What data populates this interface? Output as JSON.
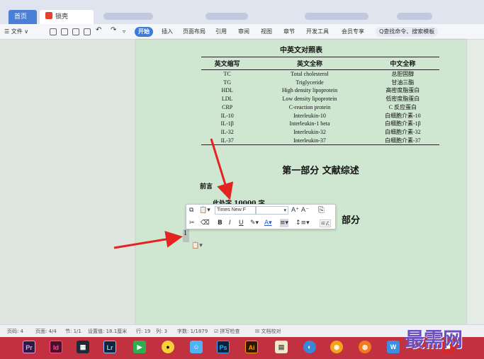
{
  "tabs": {
    "home": "首页",
    "doc": "锁壳"
  },
  "menu": {
    "file": "☰ 文件 ∨",
    "start": "开始",
    "items": [
      "插入",
      "页面布局",
      "引用",
      "审阅",
      "视图",
      "章节",
      "开发工具",
      "会员专享"
    ],
    "search_placeholder": "Q查找命令、搜索模板"
  },
  "doc": {
    "table_title": "中英文对照表",
    "columns": [
      "英文缩写",
      "英文全称",
      "中文全称"
    ],
    "rows": [
      [
        "TC",
        "Total cholesterol",
        "总胆固醇"
      ],
      [
        "TG",
        "Triglyceride",
        "甘油三酯"
      ],
      [
        "HDL",
        "High density lipoprotein",
        "高密度脂蛋白"
      ],
      [
        "LDL",
        "Low density lipoprotein",
        "低密度脂蛋白"
      ],
      [
        "CRP",
        "C-reaction protein",
        "C 反应蛋白"
      ],
      [
        "IL-10",
        "Interleukin-10",
        "白细胞介素-10"
      ],
      [
        "IL-1β",
        "Interleukin-1 beta",
        "白细胞介素-1β"
      ],
      [
        "IL-32",
        "Interleukin-32",
        "白细胞介素-32"
      ],
      [
        "IL-37",
        "Interleukin-37",
        "白细胞介素-37"
      ]
    ],
    "heading1": "第一部分 文献综述",
    "preface": "前言",
    "requirement": "此处字 10000 字",
    "heading2": "部分",
    "line_number": "1"
  },
  "mini_toolbar": {
    "font": "Times New F",
    "size": "",
    "grow": "A⁺",
    "shrink": "A⁻",
    "bold": "B",
    "italic": "I",
    "underline": "U",
    "style": "样式"
  },
  "status": {
    "page_code": "页码: 4",
    "page": "页面: 4/4",
    "section": "节: 1/1",
    "setting": "设置值: 18.1厘米",
    "row": "行: 19",
    "col": "列: 3",
    "words": "字数: 1/1879",
    "spell": "☑ 拼写检查",
    "proof": "☒ 文档校对"
  },
  "taskbar": {
    "apps": [
      "Pr",
      "Id",
      "",
      "Lr",
      "",
      "",
      "",
      "Ps",
      "Ai",
      "",
      "",
      "",
      "",
      "",
      ""
    ]
  },
  "watermark": "最需网",
  "colors": {
    "tab_active": "#4a7fd8",
    "page": "#cfe7d1",
    "taskbar": "#c2313f",
    "arrow": "#e32420"
  }
}
